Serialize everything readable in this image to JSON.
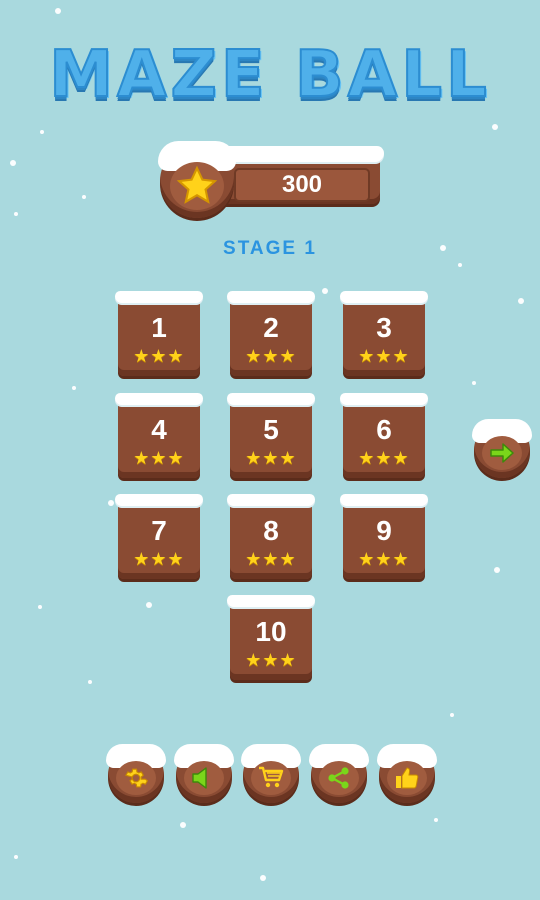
{
  "title": "MAZE BALL",
  "score": {
    "value": "300",
    "icon": "star-icon"
  },
  "stage_label": "STAGE 1",
  "levels": [
    {
      "number": "1",
      "stars": 3
    },
    {
      "number": "2",
      "stars": 3
    },
    {
      "number": "3",
      "stars": 3
    },
    {
      "number": "4",
      "stars": 3
    },
    {
      "number": "5",
      "stars": 3
    },
    {
      "number": "6",
      "stars": 3
    },
    {
      "number": "7",
      "stars": 3
    },
    {
      "number": "8",
      "stars": 3
    },
    {
      "number": "9",
      "stars": 3
    },
    {
      "number": "10",
      "stars": 3
    }
  ],
  "next_button": {
    "icon": "arrow-right-icon"
  },
  "bottom_buttons": [
    {
      "icon": "gear-icon"
    },
    {
      "icon": "sound-icon"
    },
    {
      "icon": "cart-icon"
    },
    {
      "icon": "share-icon"
    },
    {
      "icon": "thumbs-up-icon"
    }
  ],
  "colors": {
    "background": "#a9d9de",
    "wood": "#8a4b33",
    "title": "#4fb0ea",
    "stage": "#2b94e0",
    "star": "#ffd21a",
    "icon_green": "#7ad61a"
  }
}
